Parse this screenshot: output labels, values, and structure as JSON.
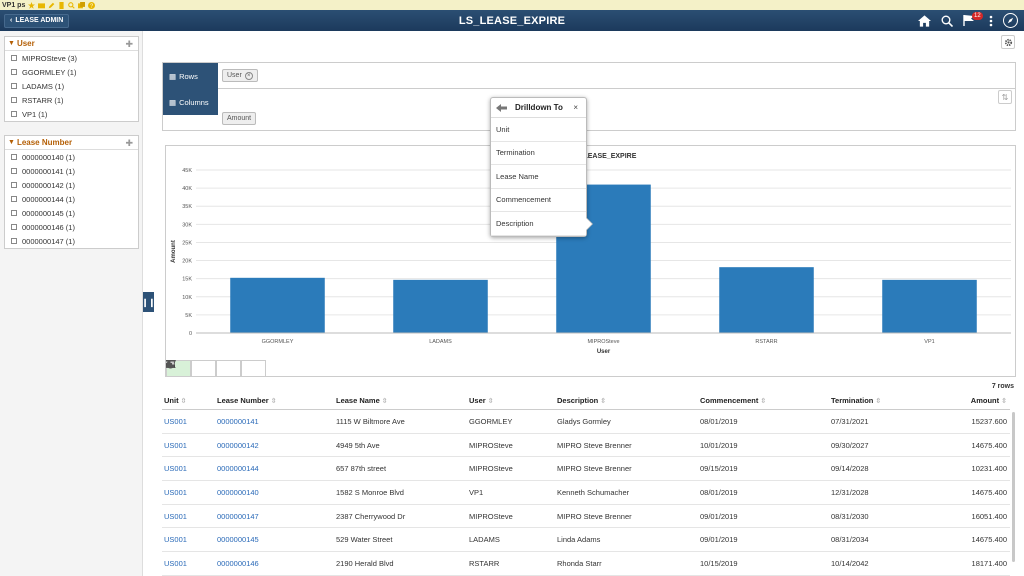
{
  "pstoolbar": {
    "label": "VP1 ps"
  },
  "header": {
    "back_label": "LEASE ADMIN",
    "title": "LS_LEASE_EXPIRE",
    "notification_count": "12"
  },
  "facets": [
    {
      "title": "User",
      "items": [
        "MIPROSteve (3)",
        "GGORMLEY (1)",
        "LADAMS (1)",
        "RSTARR (1)",
        "VP1 (1)"
      ]
    },
    {
      "title": "Lease Number",
      "items": [
        "0000000140 (1)",
        "0000000141 (1)",
        "0000000142 (1)",
        "0000000144 (1)",
        "0000000145 (1)",
        "0000000146 (1)",
        "0000000147 (1)"
      ]
    }
  ],
  "pivot": {
    "rows_label": "Rows",
    "columns_label": "Columns",
    "row_chip": "User",
    "value_chip": "Amount"
  },
  "drilldown": {
    "title": "Drilldown To",
    "close": "×",
    "items": [
      "Unit",
      "Termination",
      "Lease Name",
      "Commencement",
      "Description"
    ]
  },
  "chart_data": {
    "type": "bar",
    "title": "LS_LEASE_EXPIRE",
    "xlabel": "User",
    "ylabel": "Amount",
    "categories": [
      "GGORMLEY",
      "LADAMS",
      "MIPROSteve",
      "RSTARR",
      "VP1"
    ],
    "values": [
      15237.6,
      14675.4,
      40975.2,
      18171.4,
      14675.4
    ],
    "ylim": [
      0,
      45000
    ],
    "yticks": [
      "0",
      "5K",
      "10K",
      "15K",
      "20K",
      "25K",
      "30K",
      "35K",
      "40K",
      "45K"
    ],
    "bar_color": "#2b7bba",
    "grid": true
  },
  "grid": {
    "row_count_label": "7 rows",
    "columns": [
      "Unit",
      "Lease Number",
      "Lease Name",
      "User",
      "Description",
      "Commencement",
      "Termination",
      "Amount"
    ],
    "rows": [
      [
        "US001",
        "0000000141",
        "1115 W Biltmore Ave",
        "GGORMLEY",
        "Gladys Gormley",
        "08/01/2019",
        "07/31/2021",
        "15237.600"
      ],
      [
        "US001",
        "0000000142",
        "4949 5th Ave",
        "MIPROSteve",
        "MIPRO Steve Brenner",
        "10/01/2019",
        "09/30/2027",
        "14675.400"
      ],
      [
        "US001",
        "0000000144",
        "657 87th street",
        "MIPROSteve",
        "MIPRO Steve Brenner",
        "09/15/2019",
        "09/14/2028",
        "10231.400"
      ],
      [
        "US001",
        "0000000140",
        "1582 S Monroe Blvd",
        "VP1",
        "Kenneth Schumacher",
        "08/01/2019",
        "12/31/2028",
        "14675.400"
      ],
      [
        "US001",
        "0000000147",
        "2387 Cherrywood Dr",
        "MIPROSteve",
        "MIPRO Steve Brenner",
        "09/01/2019",
        "08/31/2030",
        "16051.400"
      ],
      [
        "US001",
        "0000000145",
        "529 Water Street",
        "LADAMS",
        "Linda Adams",
        "09/01/2019",
        "08/31/2034",
        "14675.400"
      ],
      [
        "US001",
        "0000000146",
        "2190 Herald Blvd",
        "RSTARR",
        "Rhonda Starr",
        "10/15/2019",
        "10/14/2042",
        "18171.400"
      ]
    ]
  }
}
